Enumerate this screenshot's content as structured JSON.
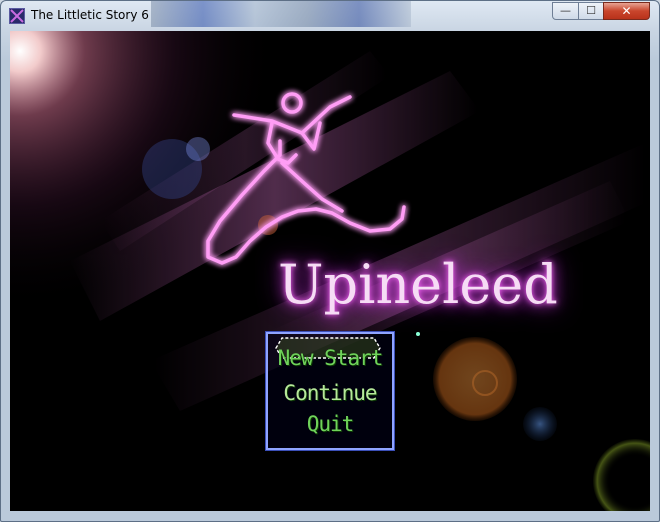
{
  "window": {
    "title": "The Littletic Story 6",
    "controls": {
      "minimize": "—",
      "maximize": "☐",
      "close": "✕"
    }
  },
  "game": {
    "logo_text": "Upineleed",
    "menu": [
      {
        "label": "New Start",
        "selected": false
      },
      {
        "label": "Continue",
        "selected": true
      },
      {
        "label": "Quit",
        "selected": false
      }
    ]
  },
  "colors": {
    "menu_text": "#6fd25a",
    "menu_border": "#8fa4ff",
    "logo_glow": "#d23de0"
  }
}
